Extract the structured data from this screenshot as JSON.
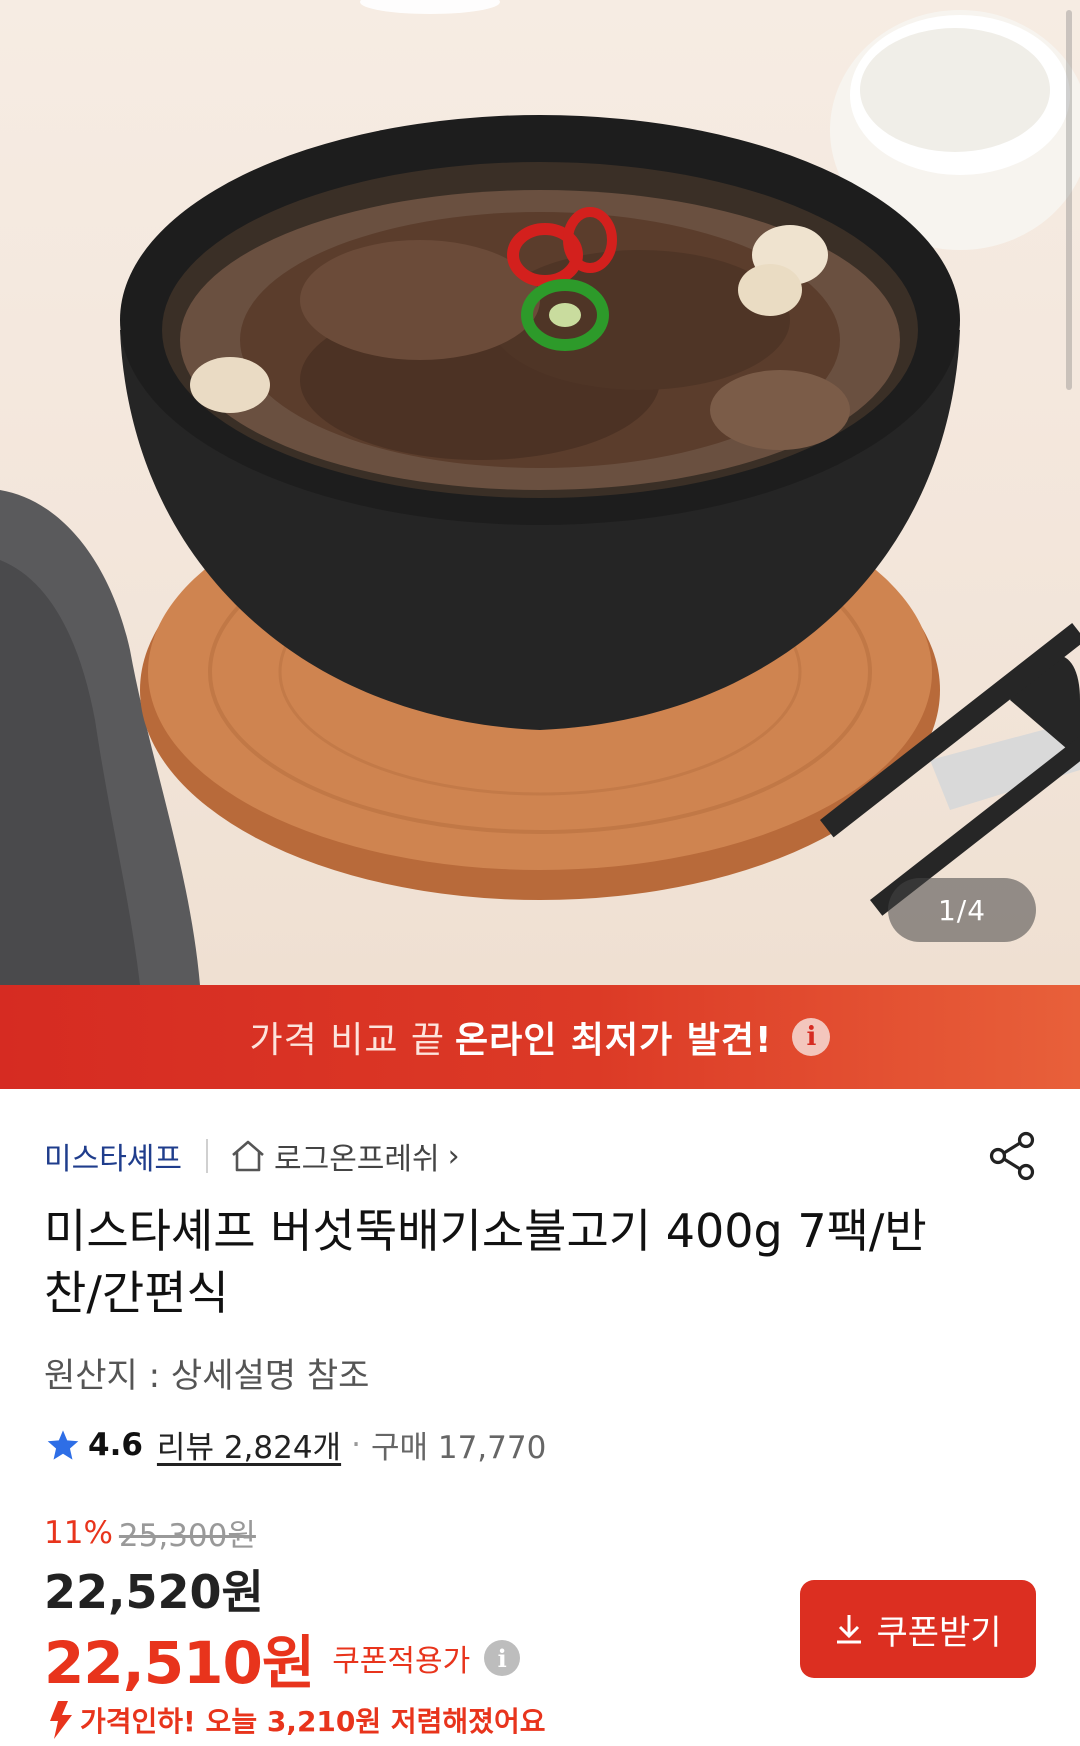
{
  "product_image": {
    "counter": "1/4"
  },
  "banner": {
    "text_plain": "가격 비교 끝",
    "text_bold": "온라인 최저가 발견!",
    "info_icon": "i"
  },
  "seller": {
    "brand": "미스타셰프",
    "store": "로그온프레쉬",
    "store_chevron": "›"
  },
  "product": {
    "title": "미스타셰프 버섯뚝배기소불고기 400g 7팩/반찬/간편식",
    "origin": "원산지 : 상세설명 참조"
  },
  "rating": {
    "score": "4.6",
    "reviews": "리뷰 2,824개",
    "separator": "·",
    "purchases": "구매 17,770"
  },
  "pricing": {
    "discount_percent": "11%",
    "original_price": "25,300원",
    "price": "22,520원",
    "coupon_price": "22,510원",
    "coupon_label": "쿠폰적용가",
    "coupon_info_icon": "i",
    "price_cut_notice": "가격인하! 오늘 3,210원 저렴해졌어요"
  },
  "actions": {
    "coupon_button": "쿠폰받기"
  },
  "colors": {
    "accent_red": "#dc2f21",
    "brand_blue": "#1f3d8c",
    "price_red": "#e8341c"
  },
  "icons": {
    "share": "share-icon",
    "home": "home-icon",
    "star": "star-icon",
    "download": "download-icon",
    "arrow_down": "price-down-icon"
  }
}
